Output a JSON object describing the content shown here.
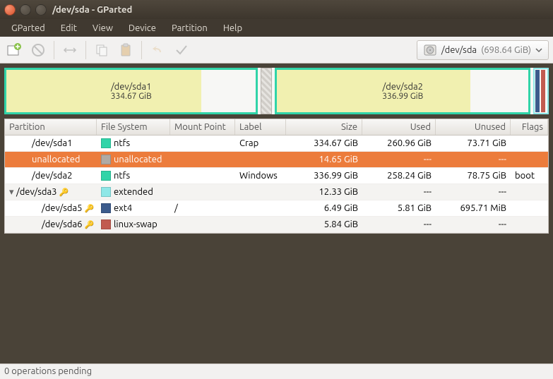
{
  "title": "/dev/sda - GParted",
  "menu": [
    "GParted",
    "Edit",
    "View",
    "Device",
    "Partition",
    "Help"
  ],
  "device": {
    "name": "/dev/sda",
    "size": "(698.64 GiB)"
  },
  "visual": [
    {
      "name": "/dev/sda1",
      "size": "334.67 GiB",
      "fill_pct": 78
    },
    {
      "name": "/dev/sda2",
      "size": "336.99 GiB",
      "fill_pct": 77
    }
  ],
  "columns": [
    "Partition",
    "File System",
    "Mount Point",
    "Label",
    "Size",
    "Used",
    "Unused",
    "Flags"
  ],
  "rows": [
    {
      "partition": "/dev/sda1",
      "indent": 1,
      "key": false,
      "exp": "",
      "fs_color": "#30d4a8",
      "fs": "ntfs",
      "mount": "",
      "label": "Crap",
      "size": "334.67 GiB",
      "used": "260.96 GiB",
      "unused": "73.71 GiB",
      "flags": "",
      "selected": false
    },
    {
      "partition": "unallocated",
      "indent": 1,
      "key": false,
      "exp": "",
      "fs_color": "#b0aaa4",
      "fs": "unallocated",
      "mount": "",
      "label": "",
      "size": "14.65 GiB",
      "used": "---",
      "unused": "---",
      "flags": "",
      "selected": true
    },
    {
      "partition": "/dev/sda2",
      "indent": 1,
      "key": false,
      "exp": "",
      "fs_color": "#30d4a8",
      "fs": "ntfs",
      "mount": "",
      "label": "Windows",
      "size": "336.99 GiB",
      "used": "258.24 GiB",
      "unused": "78.75 GiB",
      "flags": "boot",
      "selected": false
    },
    {
      "partition": "/dev/sda3",
      "indent": 0,
      "key": true,
      "exp": "▾",
      "fs_color": "#8ee7e7",
      "fs": "extended",
      "mount": "",
      "label": "",
      "size": "12.33 GiB",
      "used": "---",
      "unused": "---",
      "flags": "",
      "selected": false
    },
    {
      "partition": "/dev/sda5",
      "indent": 2,
      "key": true,
      "exp": "",
      "fs_color": "#3b5b8c",
      "fs": "ext4",
      "mount": "/",
      "label": "",
      "size": "6.49 GiB",
      "used": "5.81 GiB",
      "unused": "695.71 MiB",
      "flags": "",
      "selected": false
    },
    {
      "partition": "/dev/sda6",
      "indent": 2,
      "key": true,
      "exp": "",
      "fs_color": "#c15b50",
      "fs": "linux-swap",
      "mount": "",
      "label": "",
      "size": "5.84 GiB",
      "used": "---",
      "unused": "---",
      "flags": "",
      "selected": false
    }
  ],
  "status": "0 operations pending"
}
